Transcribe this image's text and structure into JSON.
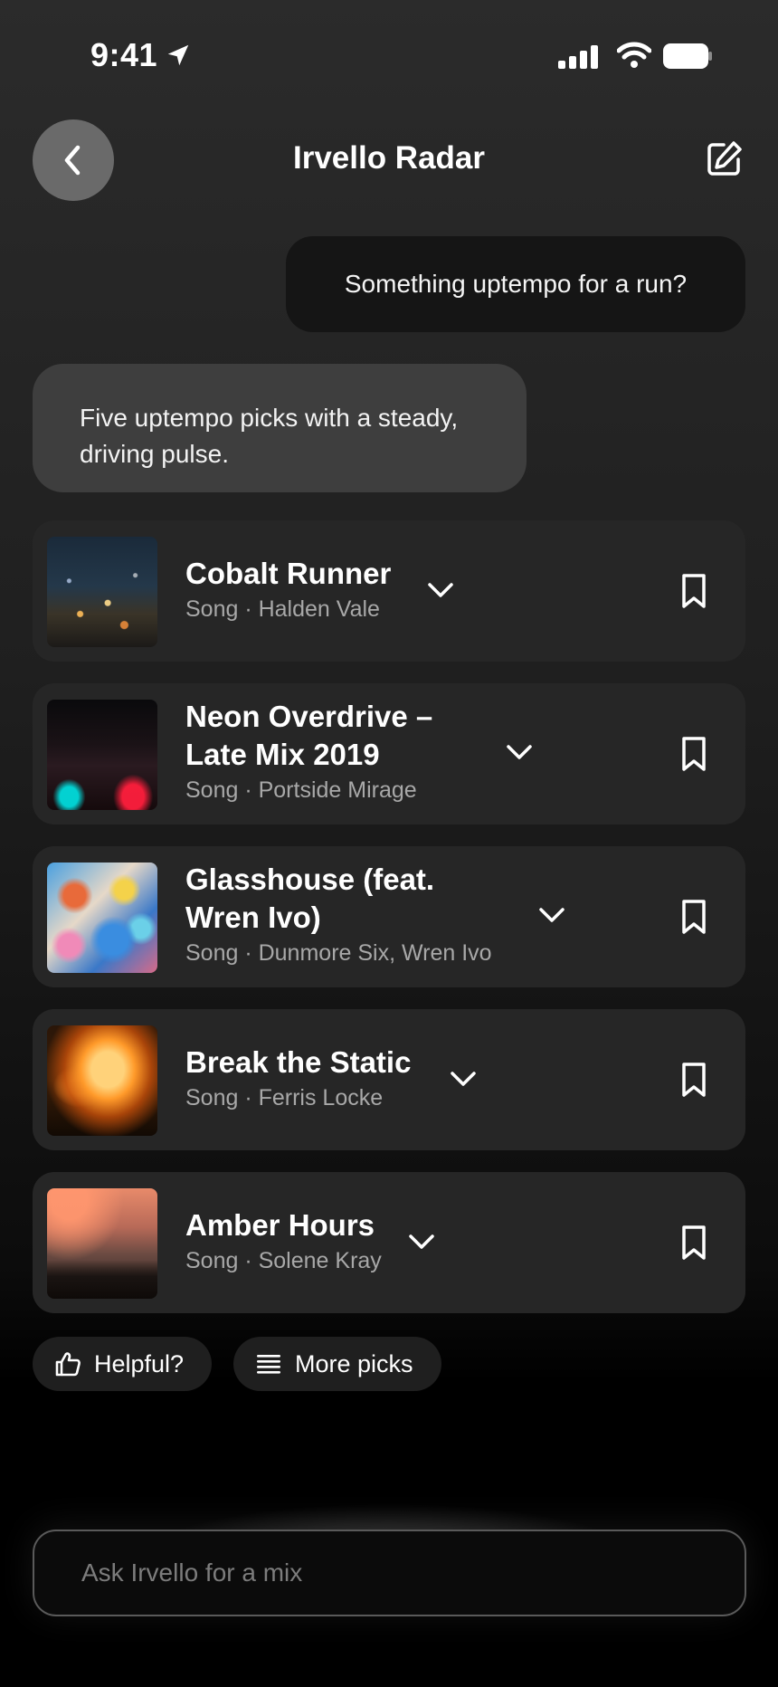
{
  "status_bar": {
    "time": "9:41"
  },
  "header": {
    "title": "Irvello Radar"
  },
  "chat": {
    "user_message": "Something uptempo for a run?",
    "bot_message": "Five uptempo picks with a steady, driving pulse."
  },
  "tracks": [
    {
      "title_line1": "Cobalt Runner",
      "title_line2": "",
      "subtitle": "Song · Halden Vale"
    },
    {
      "title_line1": "Neon Overdrive –",
      "title_line2": "Late Mix 2019",
      "subtitle": "Song · Portside Mirage"
    },
    {
      "title_line1": "Glasshouse (feat.",
      "title_line2": "Wren Ivo)",
      "subtitle": "Song · Dunmore Six, Wren Ivo"
    },
    {
      "title_line1": "Break the Static",
      "title_line2": "",
      "subtitle": "Song · Ferris Locke"
    },
    {
      "title_line1": "Amber Hours",
      "title_line2": "",
      "subtitle": "Song · Solene Kray"
    }
  ],
  "actions": {
    "helpful_label": "Helpful?",
    "more_label": "More picks"
  },
  "composer": {
    "placeholder": "Ask Irvello for a mix"
  }
}
